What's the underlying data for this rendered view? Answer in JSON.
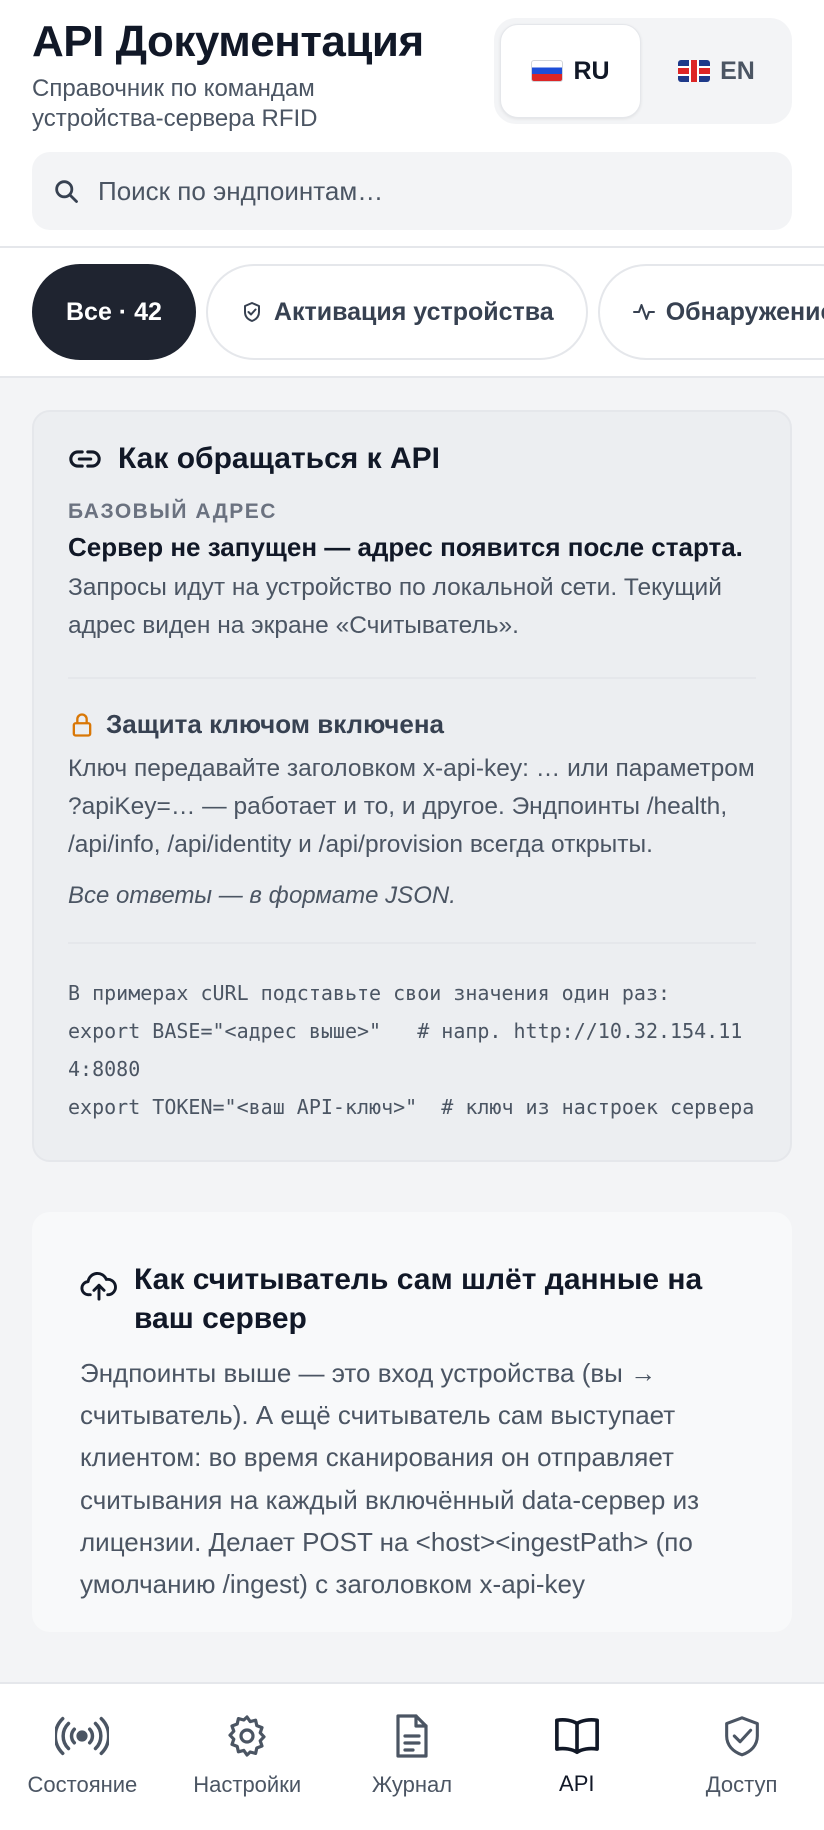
{
  "header": {
    "title": "API Документация",
    "subtitle": "Справочник по командам устройства-сервера RFID"
  },
  "lang": {
    "ru": "RU",
    "en": "EN",
    "selected": "RU"
  },
  "search": {
    "placeholder": "Поиск по эндпоинтам…"
  },
  "filters": [
    {
      "label": "Все · 42",
      "icon": "none",
      "active": true
    },
    {
      "label": "Активация устройства",
      "icon": "shield-check-icon",
      "active": false
    },
    {
      "label": "Обнаружение",
      "icon": "activity-icon",
      "active": false
    }
  ],
  "api_card": {
    "title": "Как обращаться к API",
    "base_label": "БАЗОВЫЙ АДРЕС",
    "base_status": "Сервер не запущен — адрес появится после старта.",
    "base_desc": "Запросы идут на устройство по локальной сети. Текущий адрес виден на экране «Считыватель».",
    "key_title": "Защита ключом включена",
    "key_desc": "Ключ передавайте заголовком x-api-key: … или параметром ?apiKey=… — работает и то, и другое. Эндпоинты /health, /api/info, /api/identity и /api/provision всегда открыты.",
    "json_note": "Все ответы — в формате JSON.",
    "curl": "В примерах cURL подставьте свои значения один раз:\nexport BASE=\"<адрес выше>\"   # напр. http://10.32.154.114:8080\nexport TOKEN=\"<ваш API-ключ>\"  # ключ из настроек сервера"
  },
  "push_card": {
    "title": "Как считыватель сам шлёт данные на ваш сервер",
    "desc": "Эндпоинты выше — это вход устройства (вы → считыватель). А ещё считыватель сам выступает клиентом: во время сканирования он отправляет считывания на каждый включённый data-сервер из лицензии. Делает POST на <host><ingestPath> (по умолчанию /ingest) с заголовком x-api-key"
  },
  "nav": [
    {
      "label": "Состояние",
      "icon": "broadcast-icon",
      "active": false
    },
    {
      "label": "Настройки",
      "icon": "gear-icon",
      "active": false
    },
    {
      "label": "Журнал",
      "icon": "document-icon",
      "active": false
    },
    {
      "label": "API",
      "icon": "book-icon",
      "active": true
    },
    {
      "label": "Доступ",
      "icon": "shield-check-icon",
      "active": false
    }
  ],
  "colors": {
    "accent_dark": "#1f2430",
    "lock_amber": "#d97706"
  }
}
